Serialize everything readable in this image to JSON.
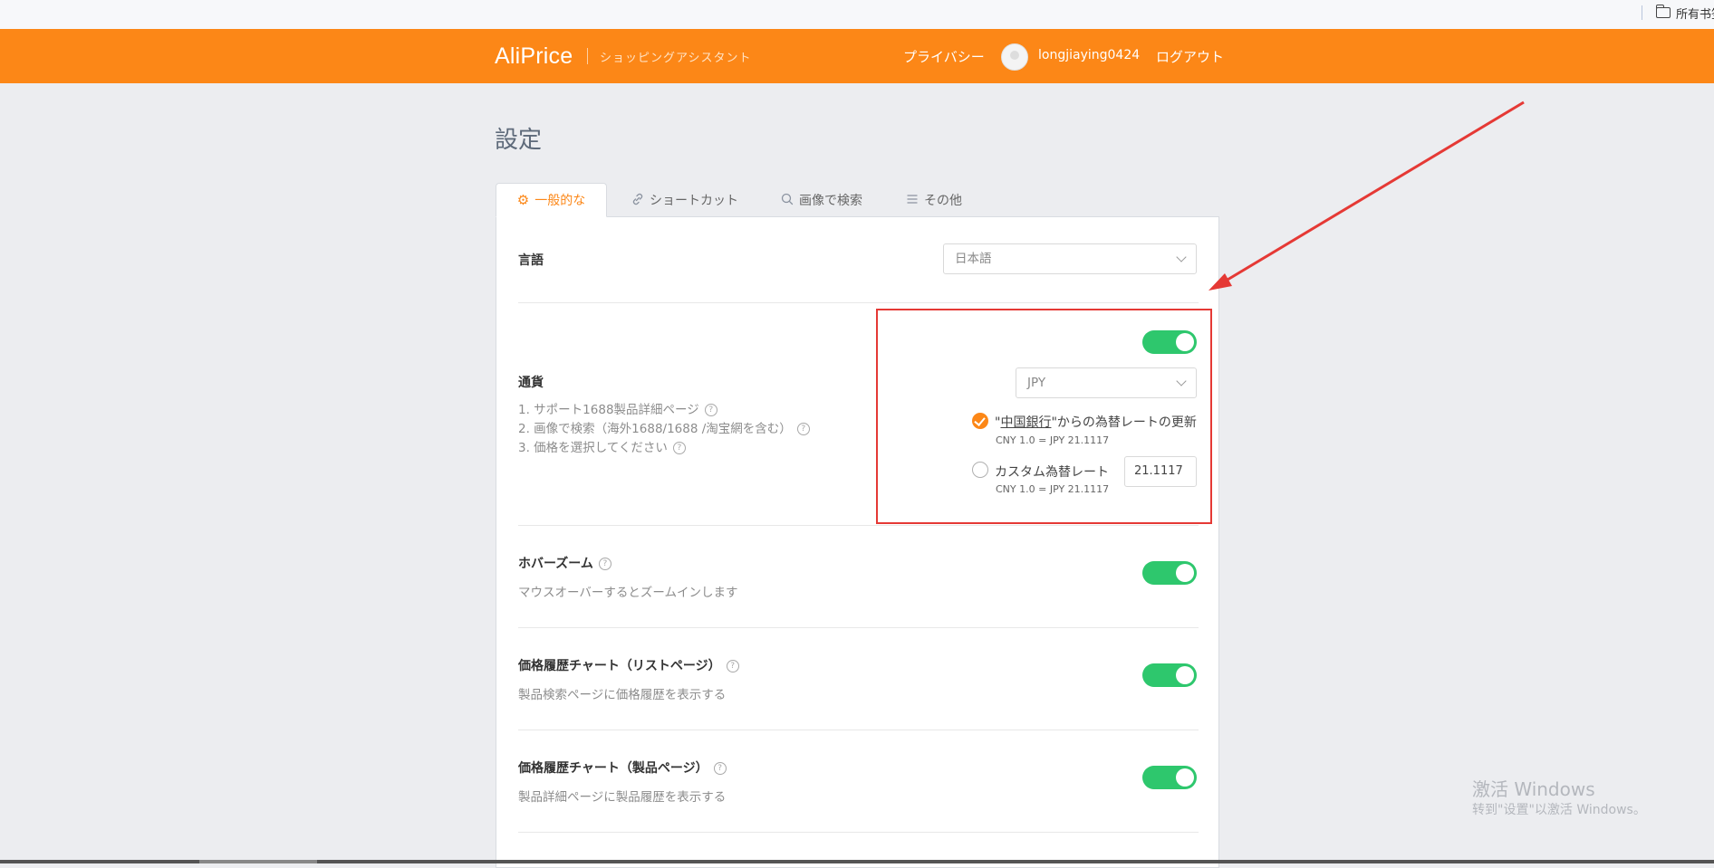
{
  "browser": {
    "bookmark_label": "所有书签"
  },
  "header": {
    "logo": "AliPrice",
    "tagline": "ショッピングアシスタント",
    "privacy": "プライバシー",
    "username": "longjiaying0424",
    "logout": "ログアウト",
    "brand_color": "#fc8717"
  },
  "page": {
    "title": "設定"
  },
  "tabs": [
    {
      "label": "一般的な",
      "icon": "gear-icon",
      "active": true
    },
    {
      "label": "ショートカット",
      "icon": "link-icon",
      "active": false
    },
    {
      "label": "画像で検索",
      "icon": "search-icon",
      "active": false
    },
    {
      "label": "その他",
      "icon": "menu-icon",
      "active": false
    }
  ],
  "language": {
    "label": "言語",
    "value": "日本語"
  },
  "currency": {
    "label": "通貨",
    "notes": [
      "1. サポート1688製品詳細ページ",
      "2. 画像で検索（海外1688/1688 /淘宝網を含む）",
      "3. 価格を選択してください"
    ],
    "enabled": true,
    "value": "JPY",
    "option_bank": {
      "quote_open": "\"",
      "bank_name": "中国銀行",
      "suffix": "\"からの為替レートの更新",
      "sub": "CNY 1.0 = JPY 21.1117",
      "selected": true
    },
    "option_custom": {
      "label": "カスタム為替レート",
      "sub": "CNY 1.0 = JPY 21.1117",
      "input_value": "21.1117",
      "selected": false
    }
  },
  "settings": [
    {
      "label": "ホバーズーム",
      "desc": "マウスオーバーするとズームインします",
      "enabled": true
    },
    {
      "label": "価格履歴チャート（リストページ）",
      "desc": "製品検索ページに価格履歴を表示する",
      "enabled": true
    },
    {
      "label": "価格履歴チャート（製品ページ）",
      "desc": "製品詳細ページに製品履歴を表示する",
      "enabled": true
    }
  ],
  "watermark": {
    "line1": "激活 Windows",
    "line2": "转到\"设置\"以激活 Windows。"
  },
  "colors": {
    "toggle_on": "#2ec76d",
    "annotation": "#e53935"
  }
}
